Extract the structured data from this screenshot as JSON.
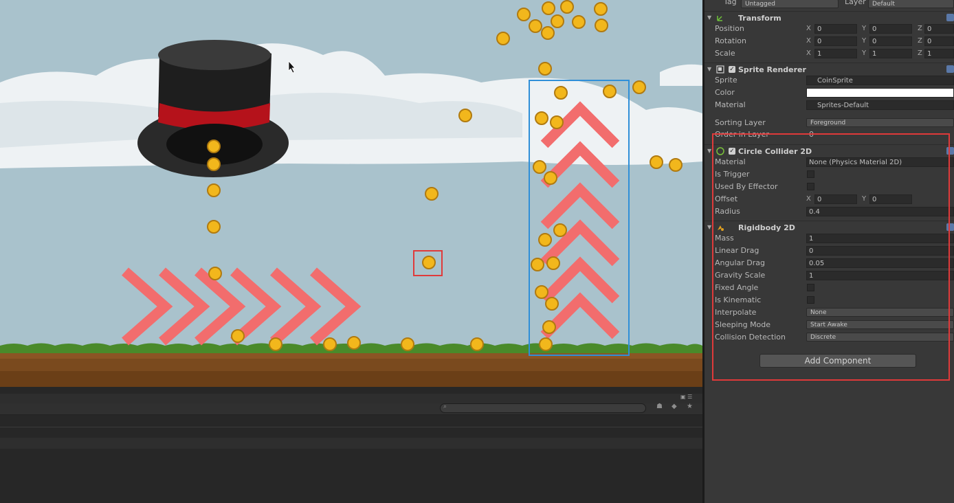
{
  "inspector": {
    "top": {
      "tag_label": "Tag",
      "tag_value": "Untagged",
      "layer_label": "Layer",
      "layer_value": "Default"
    },
    "transform": {
      "title": "Transform",
      "position": {
        "label": "Position",
        "x": "0",
        "y": "0",
        "z": "0"
      },
      "rotation": {
        "label": "Rotation",
        "x": "0",
        "y": "0",
        "z": "0"
      },
      "scale": {
        "label": "Scale",
        "x": "1",
        "y": "1",
        "z": "1"
      }
    },
    "axes": {
      "x": "X",
      "y": "Y",
      "z": "Z"
    },
    "sprite_renderer": {
      "title": "Sprite Renderer",
      "sprite_label": "Sprite",
      "sprite_value": "CoinSprite",
      "color_label": "Color",
      "material_label": "Material",
      "material_value": "Sprites-Default",
      "sorting_layer_label": "Sorting Layer",
      "sorting_layer_value": "Foreground",
      "order_label": "Order in Layer",
      "order_value": "0"
    },
    "circle_collider": {
      "title": "Circle Collider 2D",
      "material_label": "Material",
      "material_value": "None (Physics Material 2D)",
      "is_trigger_label": "Is Trigger",
      "used_by_effector_label": "Used By Effector",
      "offset_label": "Offset",
      "offset_x": "0",
      "offset_y": "0",
      "radius_label": "Radius",
      "radius_value": "0.4"
    },
    "rigidbody": {
      "title": "Rigidbody 2D",
      "mass_label": "Mass",
      "mass_value": "1",
      "linear_drag_label": "Linear Drag",
      "linear_drag_value": "0",
      "angular_drag_label": "Angular Drag",
      "angular_drag_value": "0.05",
      "gravity_label": "Gravity Scale",
      "gravity_value": "1",
      "fixed_angle_label": "Fixed Angle",
      "is_kinematic_label": "Is Kinematic",
      "interpolate_label": "Interpolate",
      "interpolate_value": "None",
      "sleeping_label": "Sleeping Mode",
      "sleeping_value": "Start Awake",
      "collision_label": "Collision Detection",
      "collision_value": "Discrete"
    },
    "add_component_label": "Add Component"
  },
  "colors": {
    "sky": "#a9c2cc",
    "ground": "#7a4a1e",
    "grass": "#4a8a2a",
    "chevron": "#f26d6d",
    "selection_blue": "#2f8fd8",
    "highlight_red": "#e03a3a",
    "coin": "#f2b71c"
  },
  "icons": [
    "transform-icon",
    "sprite-renderer-icon",
    "circle-collider-icon",
    "rigidbody-icon",
    "search-icon",
    "lock-icon",
    "help-icon"
  ]
}
